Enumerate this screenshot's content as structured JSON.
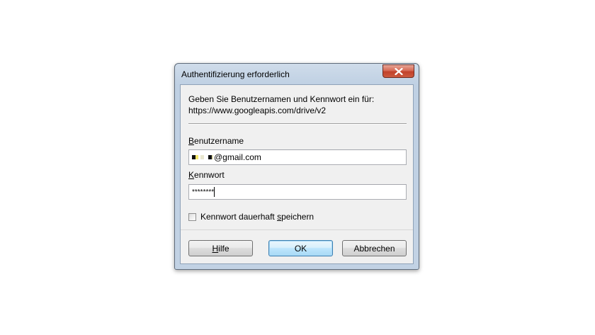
{
  "dialog": {
    "title": "Authentifizierung erforderlich",
    "intro_line1": "Geben Sie Benutzernamen und Kennwort ein für:",
    "intro_line2": "https://www.googleapis.com/drive/v2",
    "username": {
      "label_accel": "B",
      "label_rest": "enutzername",
      "value": "@gmail.com"
    },
    "password": {
      "label_accel": "K",
      "label_rest": "ennwort",
      "value": "********"
    },
    "remember": {
      "label_pre": "Kennwort dauerhaft ",
      "label_accel": "s",
      "label_post": "peichern",
      "checked": false
    },
    "buttons": {
      "help_accel": "H",
      "help_rest": "ilfe",
      "ok": "OK",
      "cancel": "Abbrechen"
    }
  },
  "colors": {
    "close_button": "#c7503a",
    "default_button_border": "#3c7fb1",
    "frame": "#bfd0e3"
  }
}
